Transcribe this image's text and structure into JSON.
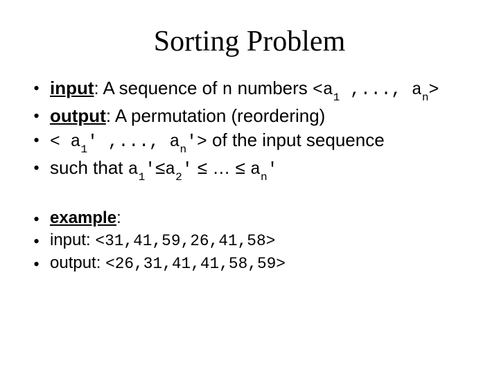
{
  "title": "Sorting Problem",
  "bullets_main": {
    "b1": {
      "label": "input",
      "text_after": ": A sequence of ",
      "n": "n",
      "text_after2": " numbers ",
      "seq_open": "<a",
      "sub1": "1",
      "seq_mid": " ,...,  a",
      "subn": "n",
      "seq_close": ">"
    },
    "b2": {
      "label": "output",
      "text_after": ": A permutation (reordering)"
    },
    "b3": {
      "seq_open": "< a",
      "sub1": "1",
      "prime1": "'",
      "seq_mid": " ,..., a",
      "subn": "n",
      "primen": "'",
      "seq_close": ">",
      "tail": " of the input sequence"
    },
    "b4": {
      "lead": "such that ",
      "a1": "a",
      "s1": "1",
      "p1": "'",
      "le1": "≤",
      "a2": "a",
      "s2": "2",
      "p2": "'",
      "lemid": " ≤ … ≤ ",
      "an": "a",
      "sn": "n",
      "pn": "'"
    }
  },
  "bullets_secondary": {
    "b5": {
      "label": "example",
      "colon": ":"
    },
    "b6": {
      "lead": "input: ",
      "seq": "<31,41,59,26,41,58>"
    },
    "b7": {
      "lead": "output: ",
      "seq": "<26,31,41,41,58,59>"
    }
  }
}
